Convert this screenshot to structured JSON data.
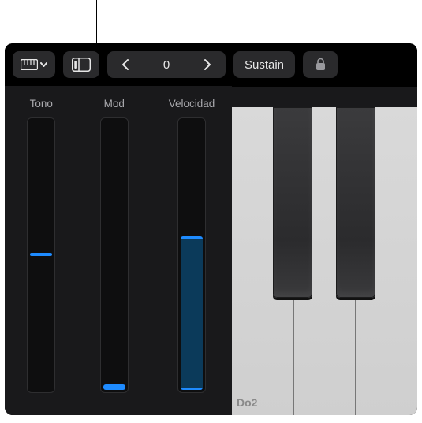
{
  "toolbar": {
    "octave_value": "0",
    "sustain_label": "Sustain"
  },
  "sliders": {
    "tono": {
      "label": "Tono",
      "handle_top_pct": 49
    },
    "mod": {
      "label": "Mod",
      "fill_pct": 2
    },
    "velocidad": {
      "label": "Velocidad",
      "fill_pct": 56
    }
  },
  "keyboard": {
    "first_white_key_label": "Do2"
  }
}
